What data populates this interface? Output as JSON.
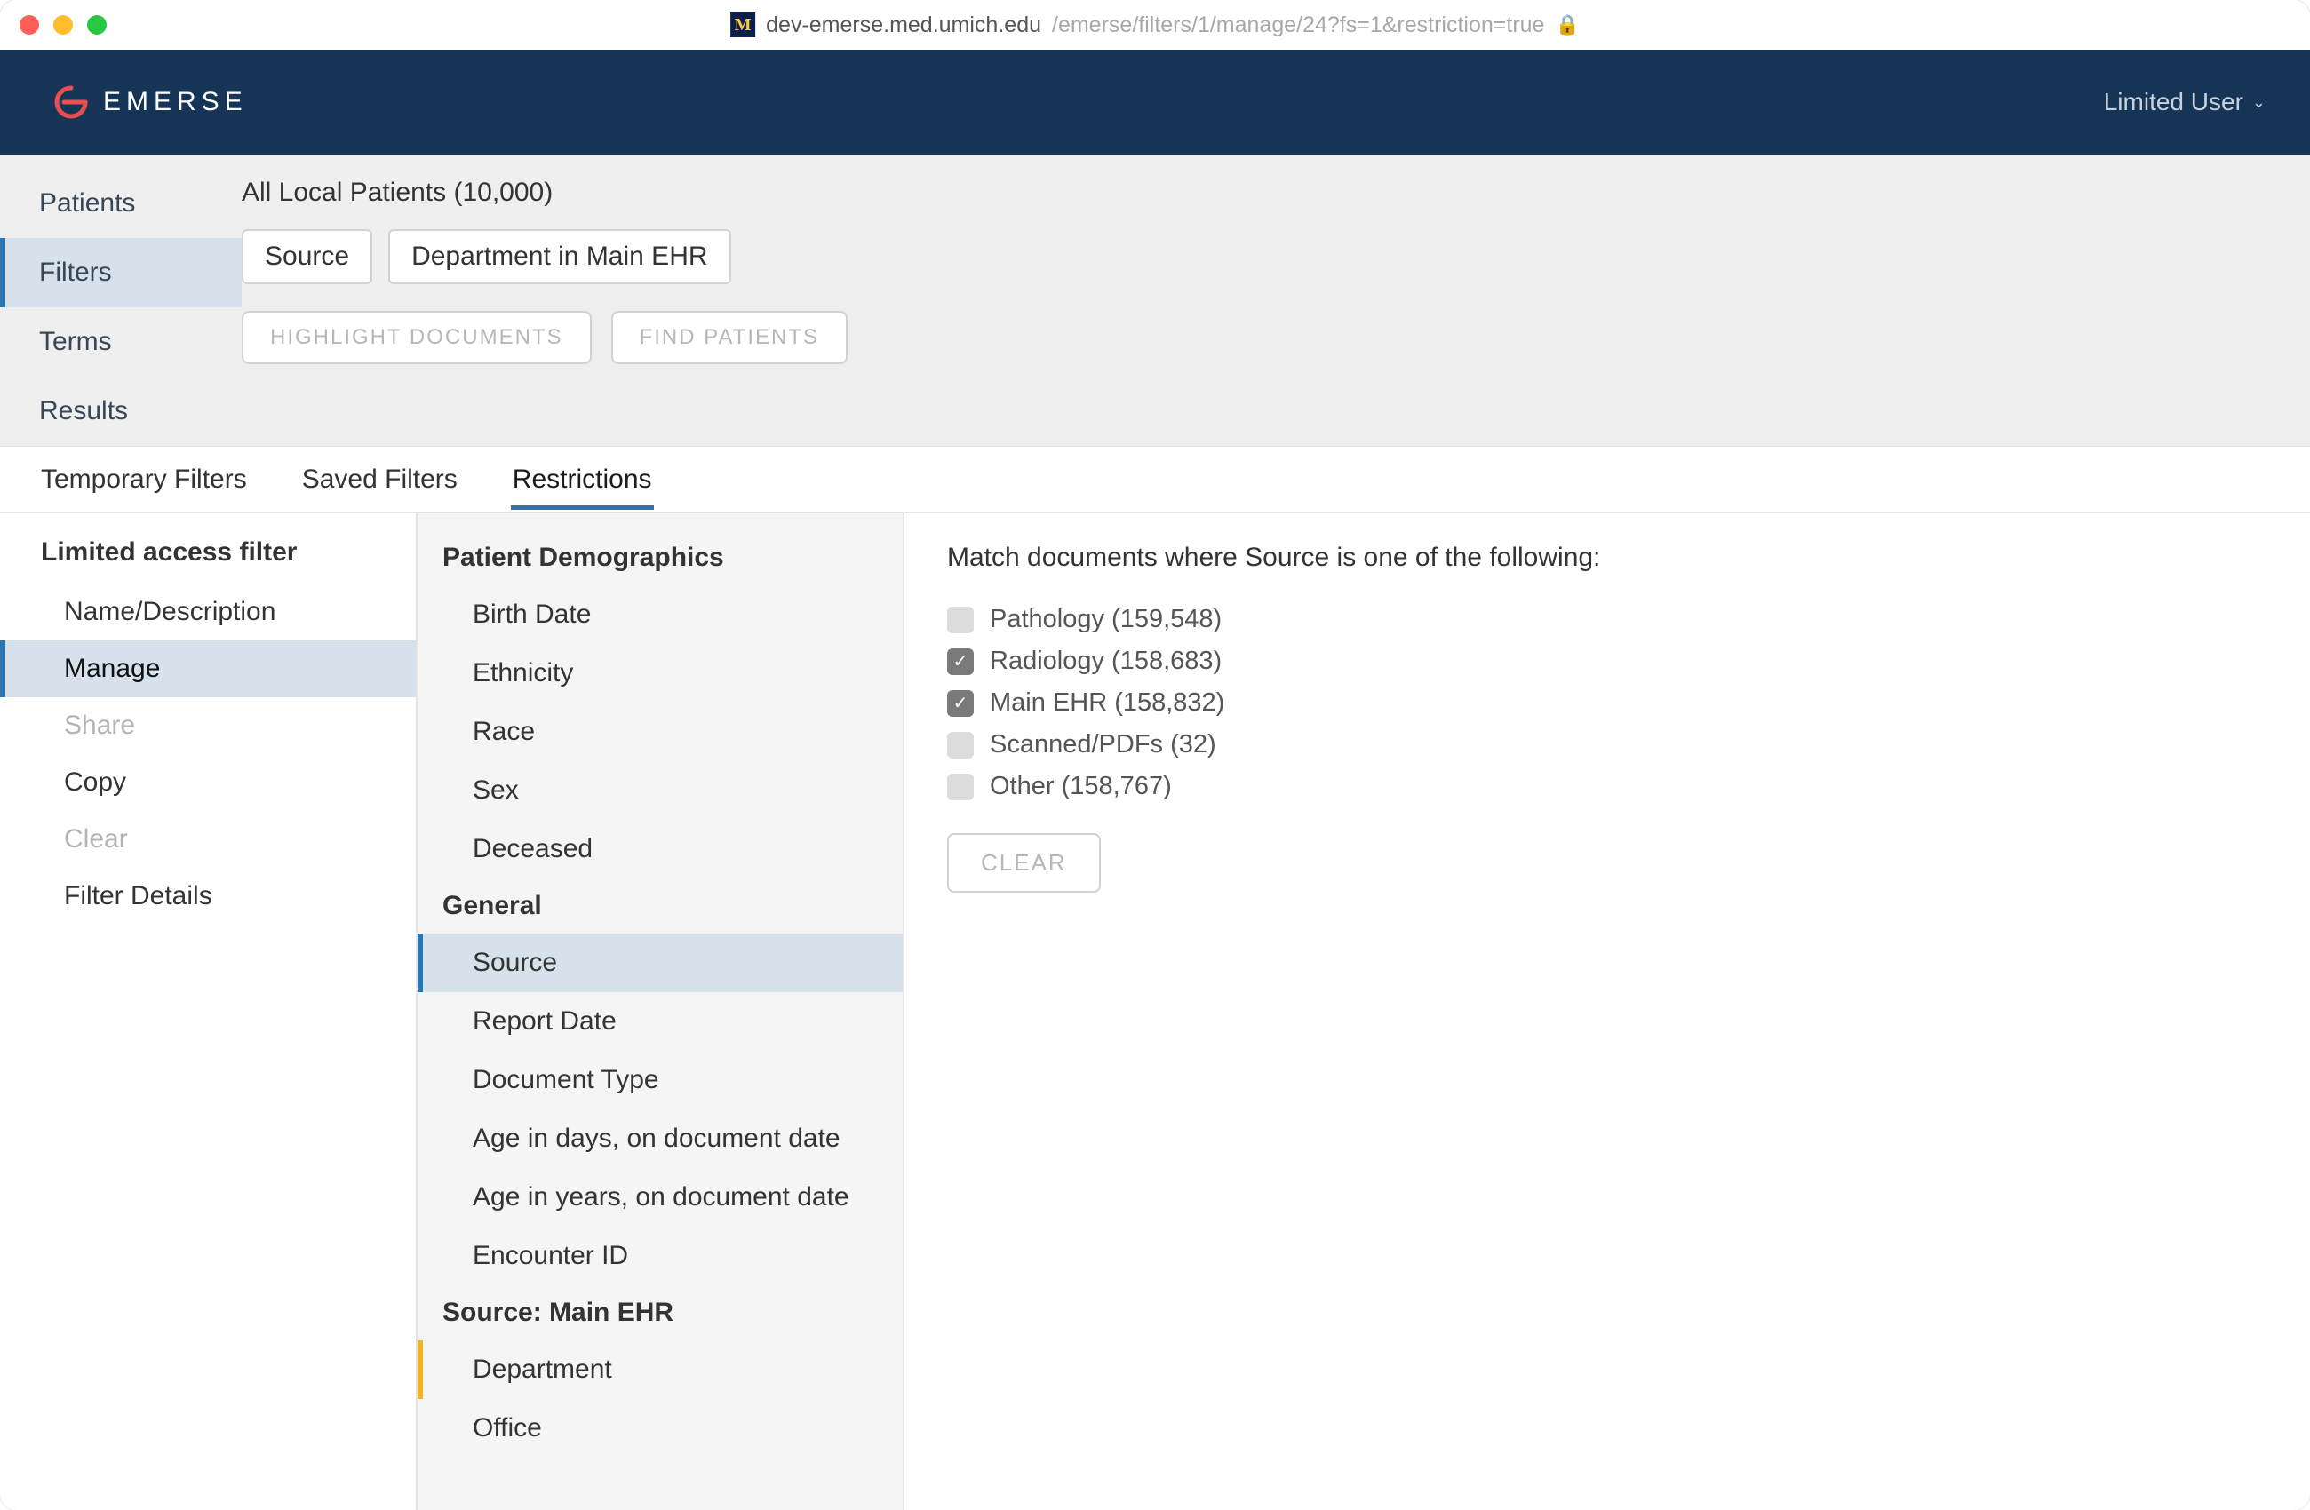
{
  "browser": {
    "url_host": "dev-emerse.med.umich.edu",
    "url_path": "/emerse/filters/1/manage/24?fs=1&restriction=true",
    "favicon_letter": "M"
  },
  "header": {
    "brand": "EMERSE",
    "user_label": "Limited User"
  },
  "primary_nav": {
    "items": [
      {
        "label": "Patients",
        "active": false
      },
      {
        "label": "Filters",
        "active": true
      },
      {
        "label": "Terms",
        "active": false
      },
      {
        "label": "Results",
        "active": false
      }
    ]
  },
  "summary": {
    "population": "All Local Patients (10,000)",
    "chips": [
      "Source",
      "Department in Main EHR"
    ],
    "highlight_btn": "HIGHLIGHT DOCUMENTS",
    "find_btn": "FIND PATIENTS"
  },
  "filter_tabs": {
    "items": [
      {
        "label": "Temporary Filters",
        "active": false
      },
      {
        "label": "Saved Filters",
        "active": false
      },
      {
        "label": "Restrictions",
        "active": true
      }
    ]
  },
  "left_panel": {
    "title": "Limited access filter",
    "items": [
      {
        "label": "Name/Description",
        "active": false,
        "disabled": false
      },
      {
        "label": "Manage",
        "active": true,
        "disabled": false
      },
      {
        "label": "Share",
        "active": false,
        "disabled": true
      },
      {
        "label": "Copy",
        "active": false,
        "disabled": false
      },
      {
        "label": "Clear",
        "active": false,
        "disabled": true
      },
      {
        "label": "Filter Details",
        "active": false,
        "disabled": false
      }
    ]
  },
  "mid_panel": {
    "groups": [
      {
        "header": "Patient Demographics",
        "items": [
          {
            "label": "Birth Date",
            "state": "plain"
          },
          {
            "label": "Ethnicity",
            "state": "plain"
          },
          {
            "label": "Race",
            "state": "plain"
          },
          {
            "label": "Sex",
            "state": "plain"
          },
          {
            "label": "Deceased",
            "state": "plain"
          }
        ]
      },
      {
        "header": "General",
        "items": [
          {
            "label": "Source",
            "state": "active-blue"
          },
          {
            "label": "Report Date",
            "state": "plain"
          },
          {
            "label": "Document Type",
            "state": "plain"
          },
          {
            "label": "Age in days, on document date",
            "state": "plain"
          },
          {
            "label": "Age in years, on document date",
            "state": "plain"
          },
          {
            "label": "Encounter ID",
            "state": "plain"
          }
        ]
      },
      {
        "header": "Source: Main EHR",
        "items": [
          {
            "label": "Department",
            "state": "amber"
          },
          {
            "label": "Office",
            "state": "plain"
          }
        ]
      }
    ]
  },
  "right_panel": {
    "match_text": "Match documents where Source is one of the following:",
    "options": [
      {
        "label": "Pathology (159,548)",
        "checked": false
      },
      {
        "label": "Radiology (158,683)",
        "checked": true
      },
      {
        "label": "Main EHR (158,832)",
        "checked": true
      },
      {
        "label": "Scanned/PDFs (32)",
        "checked": false
      },
      {
        "label": "Other (158,767)",
        "checked": false
      }
    ],
    "clear_btn": "CLEAR"
  }
}
